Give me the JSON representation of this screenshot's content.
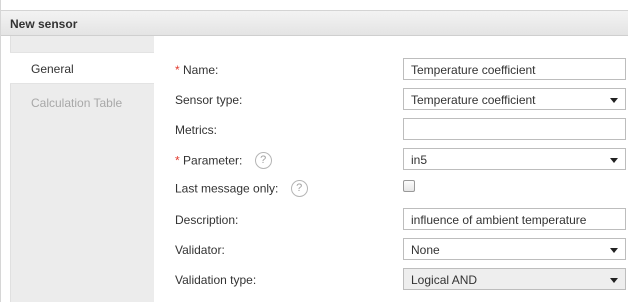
{
  "dialog": {
    "title": "New sensor"
  },
  "tabs": [
    {
      "label": "General",
      "active": true
    },
    {
      "label": "Calculation Table",
      "active": false
    }
  ],
  "form": {
    "required_mark": "*",
    "help_glyph": "?",
    "name": {
      "label": "Name:",
      "value": "Temperature coefficient"
    },
    "sensor_type": {
      "label": "Sensor type:",
      "value": "Temperature coefficient"
    },
    "metrics": {
      "label": "Metrics:",
      "value": ""
    },
    "parameter": {
      "label": "Parameter:",
      "value": "in5"
    },
    "last_message_only": {
      "label": "Last message only:",
      "checked": false
    },
    "description": {
      "label": "Description:",
      "value": "influence of ambient temperature"
    },
    "validator": {
      "label": "Validator:",
      "value": "None"
    },
    "validation_type": {
      "label": "Validation type:",
      "value": "Logical AND"
    }
  },
  "colors": {
    "required": "#e23b2e",
    "inactive_tab": "#a8a8a8",
    "disabled_select_bg": "#eeeeee"
  }
}
